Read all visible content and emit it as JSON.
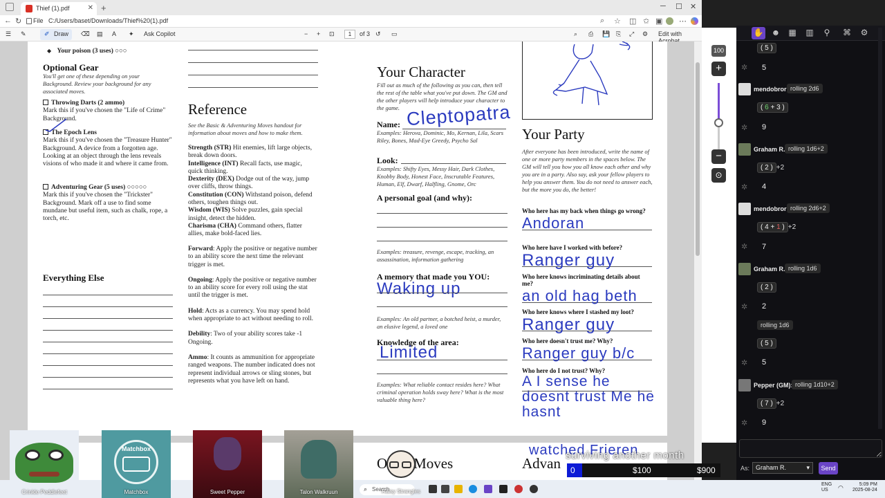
{
  "browser": {
    "tab_title": "Thief (1).pdf",
    "file_label": "File",
    "url": "C:/Users/baset/Downloads/Thief%20(1).pdf"
  },
  "pdf_toolbar": {
    "draw_label": "Draw",
    "ask_copilot_label": "Ask Copilot",
    "page_current": "1",
    "page_total": "of 3",
    "edit_label": "Edit with Acrobat"
  },
  "doc": {
    "col1": {
      "poison": "Your poison (3 uses) ○○○",
      "optional_gear_title": "Optional Gear",
      "optional_gear_desc": "You'll get one of these depending on your Background. Review your background for any associated moves.",
      "gear": [
        {
          "name": "Throwing Darts (2 ammo)",
          "desc": "Mark this if you've chosen the \"Life of Crime\" Background."
        },
        {
          "name": "The Epoch Lens",
          "desc": "Mark this if you've chosen the \"Treasure Hunter\" Background. A device from a forgotten age. Looking at an object through the lens reveals visions of who made it and where it came from."
        },
        {
          "name": "Adventuring Gear (5 uses) ○○○○○",
          "desc": "Mark this if you've chosen the \"Trickster\" Background. Mark off a use to find some mundane but useful item, such as chalk, rope, a torch, etc."
        }
      ],
      "everything_else_title": "Everything Else"
    },
    "col2": {
      "reference_title": "Reference",
      "reference_intro": "See the Basic & Adventuring Moves handout for information about moves and how to make them.",
      "stats": [
        {
          "name": "Strength (STR)",
          "desc": " Hit enemies, lift large objects, break down doors."
        },
        {
          "name": "Intelligence (INT)",
          "desc": " Recall facts, use magic, quick thinking."
        },
        {
          "name": "Dexterity (DEX)",
          "desc": " Dodge out of the way, jump over cliffs, throw things."
        },
        {
          "name": "Constitution (CON)",
          "desc": " Withstand poison, defend others, toughen things out."
        },
        {
          "name": "Wisdom (WIS)",
          "desc": " Solve puzzles, gain special insight, detect the hidden."
        },
        {
          "name": "Charisma (CHA)",
          "desc": " Command others, flatter allies, make bold-faced lies."
        }
      ],
      "terms": [
        {
          "name": "Forward",
          "desc": ": Apply the positive or negative number to an ability score the next time the relevant trigger is met."
        },
        {
          "name": "Ongoing",
          "desc": ": Apply the positive or negative number to an ability score for every roll using the stat until the trigger is met."
        },
        {
          "name": "Hold",
          "desc": ": Acts as a currency. You may spend hold when appropriate to act without needing to roll."
        },
        {
          "name": "Debility",
          "desc": ": Two of your ability scores take -1 Ongoing."
        },
        {
          "name": "Ammo",
          "desc": ": It counts as ammunition for appropriate ranged weapons. The number indicated does not represent individual arrows or sling stones, but represents what you have left on hand."
        }
      ]
    },
    "col3": {
      "title": "Your Character",
      "intro": "Fill out as much of the following as you can, then tell the rest of the table what you've put down. The GM and the other players will help introduce your character to the game.",
      "name_label": "Name:",
      "name_value": "Cleptopatra",
      "name_examples": "Examples: Herova, Dominic, Mo, Kernan, Lila, Scars Riley, Bones, Mad-Eye Greedy, Psycho Sal",
      "look_label": "Look:",
      "look_examples": "Examples: Shifty Eyes, Messy Hair, Dark Clothes, Knobby Body, Honest Face, Inscrutable Features, Human, Elf, Dwarf, Halfling, Gnome, Orc",
      "goal_label": "A personal goal (and why):",
      "goal_examples": "Examples: treasure, revenge, escape, tracking, an assassination, information gathering",
      "memory_label": "A memory that made you YOU:",
      "memory_value": "Waking up",
      "memory_examples": "Examples: An old partner, a botched heist, a murder, an elusive legend, a loved one",
      "knowledge_label": "Knowledge of the area:",
      "knowledge_value": "Limited",
      "knowledge_examples": "Examples: What reliable contact resides here? What criminal operation holds sway here? What is the most valuable thing here?",
      "bottom_heading": "Other Moves"
    },
    "col4": {
      "title": "Your Party",
      "intro": "After everyone has been introduced, write the name of one or more party members in the spaces below. The GM will tell you how you all know each other and why you are in a party. Also say, ask your fellow players to help you answer them. You do not need to answer each, but the more you do, the better!",
      "questions": [
        {
          "q": "Who here has my back when things go wrong?",
          "a": "Andoran"
        },
        {
          "q": "Who here have I worked with before?",
          "a": "Ranger guy"
        },
        {
          "q": "Who here knows incriminating details about me?",
          "a": "an old hag beth"
        },
        {
          "q": "Who here knows where I stashed my loot?",
          "a": "Ranger guy"
        },
        {
          "q": "Who here doesn't trust me? Why?",
          "a": "Ranger guy b/c"
        },
        {
          "q": "Who here do I not trust? Why?",
          "a": "A I sense he doesnt trust Me he hasnt"
        }
      ],
      "bottom_handwriting": "watched Frieren",
      "bottom_heading": "Advan"
    }
  },
  "zoom": {
    "level": "100"
  },
  "chat": {
    "header_icons": [
      "dice-icon",
      "character-icon",
      "journal-icon",
      "library-icon",
      "settings-sliders-icon",
      "network-icon",
      "gear-icon"
    ],
    "messages": [
      {
        "type": "result",
        "dice": [
          "5"
        ],
        "mod": "",
        "total": "5"
      },
      {
        "type": "roll",
        "user": "mendobror:",
        "action": "rolling 2d6"
      },
      {
        "type": "result",
        "dice": [
          "6",
          "3"
        ],
        "mod": "",
        "total": "9"
      },
      {
        "type": "roll",
        "user": "Graham R.:",
        "action": "rolling 1d6+2"
      },
      {
        "type": "result",
        "dice": [
          "2"
        ],
        "mod": "+2",
        "total": "4"
      },
      {
        "type": "roll",
        "user": "mendobror:",
        "action": "rolling 2d6+2"
      },
      {
        "type": "result",
        "dice": [
          "4",
          "1"
        ],
        "mod": "+2",
        "total": "7"
      },
      {
        "type": "roll",
        "user": "Graham R.:",
        "action": "rolling 1d6"
      },
      {
        "type": "result",
        "dice": [
          "2"
        ],
        "mod": "",
        "total": "2"
      },
      {
        "type": "roll-continued",
        "action": "rolling 1d6"
      },
      {
        "type": "result",
        "dice": [
          "5"
        ],
        "mod": "",
        "total": "5"
      },
      {
        "type": "roll",
        "user": "Pepper (GM):",
        "action": "rolling 1d10+2"
      },
      {
        "type": "result",
        "dice": [
          "7"
        ],
        "mod": "+2",
        "total": "9"
      }
    ],
    "as_label": "As:",
    "as_value": "Graham R.",
    "send_label": "Send"
  },
  "stream": {
    "overlay_text": "surviving another month",
    "goal_current": "0",
    "goal_mid": "$100",
    "goal_max": "$900",
    "cams": [
      "Crinkle Peddlefeet",
      "Matchbox",
      "Sweet Pepper",
      "Talon Walkruun",
      "Raisy Strangles"
    ],
    "matchbox_logo": "Matchbox"
  },
  "taskbar": {
    "search_placeholder": "Search",
    "lang": "ENG",
    "region": "US",
    "time": "5:09 PM",
    "date": "2025-08-24"
  },
  "colors": {
    "ink": "#2b3bbf",
    "accent": "#6a44c6",
    "goal_bar": "#0d1bd6"
  }
}
